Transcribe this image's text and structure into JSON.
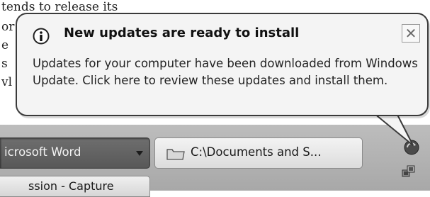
{
  "document": {
    "lines": [
      "tends to release its",
      "or",
      "e",
      "s",
      "vl"
    ]
  },
  "balloon": {
    "title": "New updates are ready to install",
    "body": "Updates for your computer have been downloaded from Windows Update. Click here to review these updates and install them.",
    "close_label": "✕",
    "icon": "info-icon"
  },
  "taskbar": {
    "buttons": [
      {
        "label": "icrosoft Word",
        "icon": "dropdown-arrow-icon"
      },
      {
        "label": "C:\\Documents and S...",
        "icon": "folder-icon"
      },
      {
        "label": "ssion - Capture",
        "icon": ""
      }
    ],
    "tray": [
      "windows-update-icon",
      "network-icon"
    ]
  },
  "colors": {
    "balloon_bg": "#f4f4f4",
    "taskbar_bg": "#b2b2b2",
    "active_task_bg": "#626262"
  }
}
